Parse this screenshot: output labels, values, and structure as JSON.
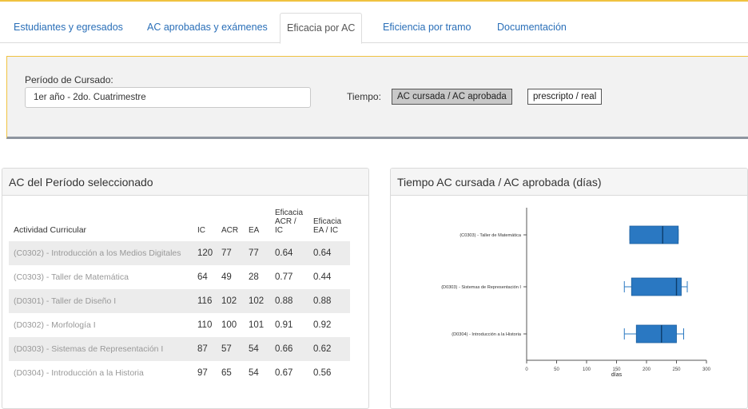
{
  "tabs": [
    {
      "label": "Estudiantes y egresados"
    },
    {
      "label": "AC aprobadas y exámenes"
    },
    {
      "label": "Eficacia por AC"
    },
    {
      "label": "Eficiencia por tramo"
    },
    {
      "label": "Documentación"
    }
  ],
  "filters": {
    "period_label": "Período de Cursado:",
    "period_value": "1er año - 2do. Cuatrimestre",
    "tiempo_label": "Tiempo:",
    "tiempo_options": [
      "AC cursada / AC aprobada",
      "prescripto / real"
    ],
    "tiempo_selected": "AC cursada / AC aprobada"
  },
  "table_card": {
    "title": "AC del Período seleccionado",
    "headers": {
      "actividad": "Actividad Curricular",
      "ic": "IC",
      "acr": "ACR",
      "ea": "EA",
      "ef1_l1": "Eficacia",
      "ef1_l2": "ACR /",
      "ef1_l3": "IC",
      "ef2_l1": "Eficacia",
      "ef2_l2": "EA / IC"
    },
    "rows": [
      {
        "actividad": "(C0302) - Introducción a los Medios Digitales",
        "ic": "120",
        "acr": "77",
        "ea": "77",
        "ef1": "0.64",
        "ef2": "0.64"
      },
      {
        "actividad": "(C0303) - Taller de Matemática",
        "ic": "64",
        "acr": "49",
        "ea": "28",
        "ef1": "0.77",
        "ef2": "0.44"
      },
      {
        "actividad": "(D0301) - Taller de Diseño I",
        "ic": "116",
        "acr": "102",
        "ea": "102",
        "ef1": "0.88",
        "ef2": "0.88"
      },
      {
        "actividad": "(D0302) - Morfología I",
        "ic": "110",
        "acr": "100",
        "ea": "101",
        "ef1": "0.91",
        "ef2": "0.92"
      },
      {
        "actividad": "(D0303) - Sistemas de Representación I",
        "ic": "87",
        "acr": "57",
        "ea": "54",
        "ef1": "0.66",
        "ef2": "0.62"
      },
      {
        "actividad": "(D0304) - Introducción a la Historia",
        "ic": "97",
        "acr": "65",
        "ea": "54",
        "ef1": "0.67",
        "ef2": "0.56"
      }
    ]
  },
  "chart_card": {
    "title": "Tiempo AC cursada / AC aprobada (días)"
  },
  "chart_data": {
    "type": "boxplot",
    "orientation": "horizontal",
    "xlabel": "días",
    "xlim": [
      0,
      300
    ],
    "xticks": [
      0,
      50,
      100,
      150,
      200,
      250,
      300
    ],
    "color": "#2a78c2",
    "series": [
      {
        "category": "(C0303) - Taller de Matemática",
        "whisker_low": 172,
        "q1": 172,
        "median": 227,
        "q3": 253,
        "whisker_high": 253
      },
      {
        "category": "(D0303) - Sistemas de Representación I",
        "whisker_low": 163,
        "q1": 175,
        "median": 250,
        "q3": 258,
        "whisker_high": 268
      },
      {
        "category": "(D0304) - Introducción a la Historia",
        "whisker_low": 163,
        "q1": 183,
        "median": 225,
        "q3": 250,
        "whisker_high": 262
      }
    ]
  }
}
